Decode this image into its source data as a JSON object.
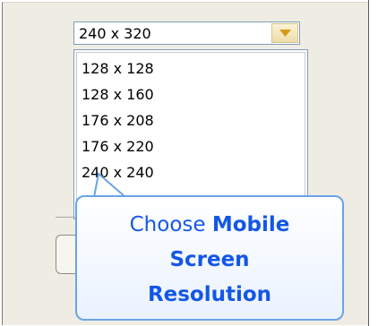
{
  "resolution_select": {
    "selected": "240 x 320",
    "options": [
      "128 x 128",
      "128 x 160",
      "176 x 208",
      "176 x 220",
      "240 x 240"
    ],
    "partial_option_visible": "x 240"
  },
  "tooltip": {
    "line1_regular": "Choose",
    "line1_bold": "Mobile",
    "line2": "Screen",
    "line3": "Resolution"
  }
}
